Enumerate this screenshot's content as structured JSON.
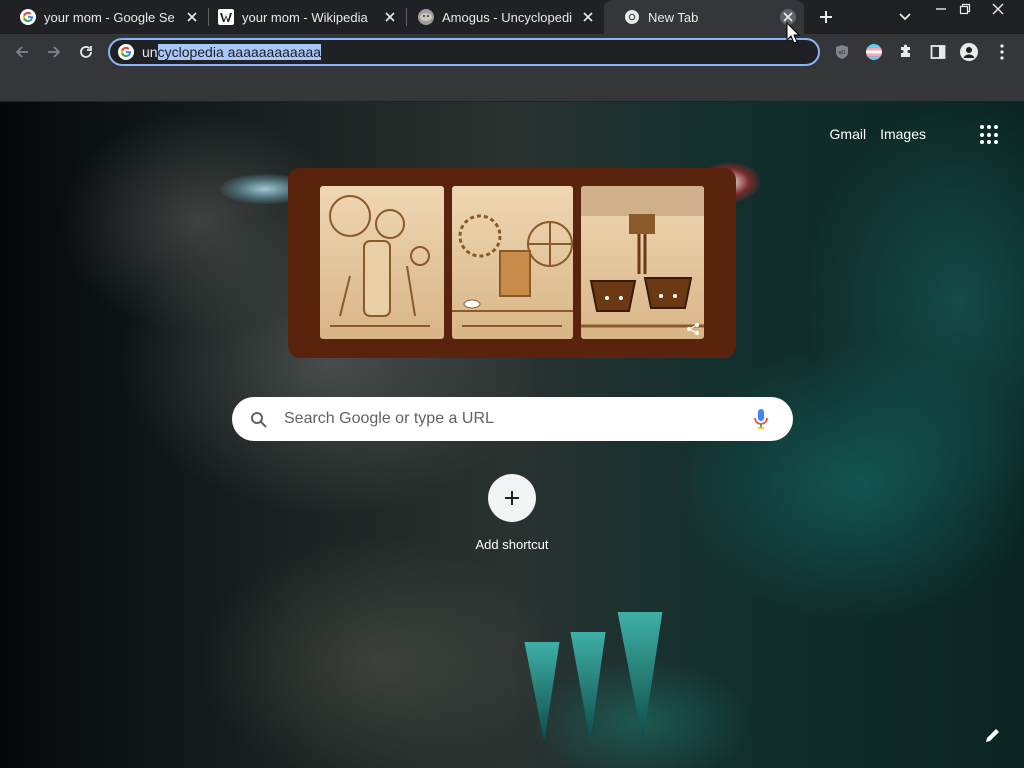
{
  "tabs": [
    {
      "title": "your mom - Google Search",
      "favicon": "google-g-icon"
    },
    {
      "title": "your mom - Wikipedia",
      "favicon": "wikipedia-w-icon"
    },
    {
      "title": "Amogus - Uncyclopedia",
      "favicon": "uncyclopedia-potato-icon"
    },
    {
      "title": "New Tab",
      "favicon": "chrome-icon",
      "active": true
    }
  ],
  "toolbar": {
    "omnibox_prefix": "un",
    "omnibox_selected": "cyclopedia aaaaaaaaaaaa",
    "extensions": [
      "ublock-origin-icon",
      "profile-flag-icon",
      "extensions-puzzle-icon",
      "side-panel-icon",
      "account-icon",
      "menu-kebab-icon"
    ]
  },
  "ntp": {
    "links": {
      "gmail": "Gmail",
      "images": "Images"
    },
    "search_placeholder": "Search Google or type a URL",
    "shortcut_label": "Add shortcut"
  },
  "colors": {
    "tabstrip": "#202124",
    "toolbar": "#35363a",
    "omnibox_border": "#8ab4f8",
    "doodle_frame": "#5a230e",
    "selection": "#a8c7fa"
  }
}
